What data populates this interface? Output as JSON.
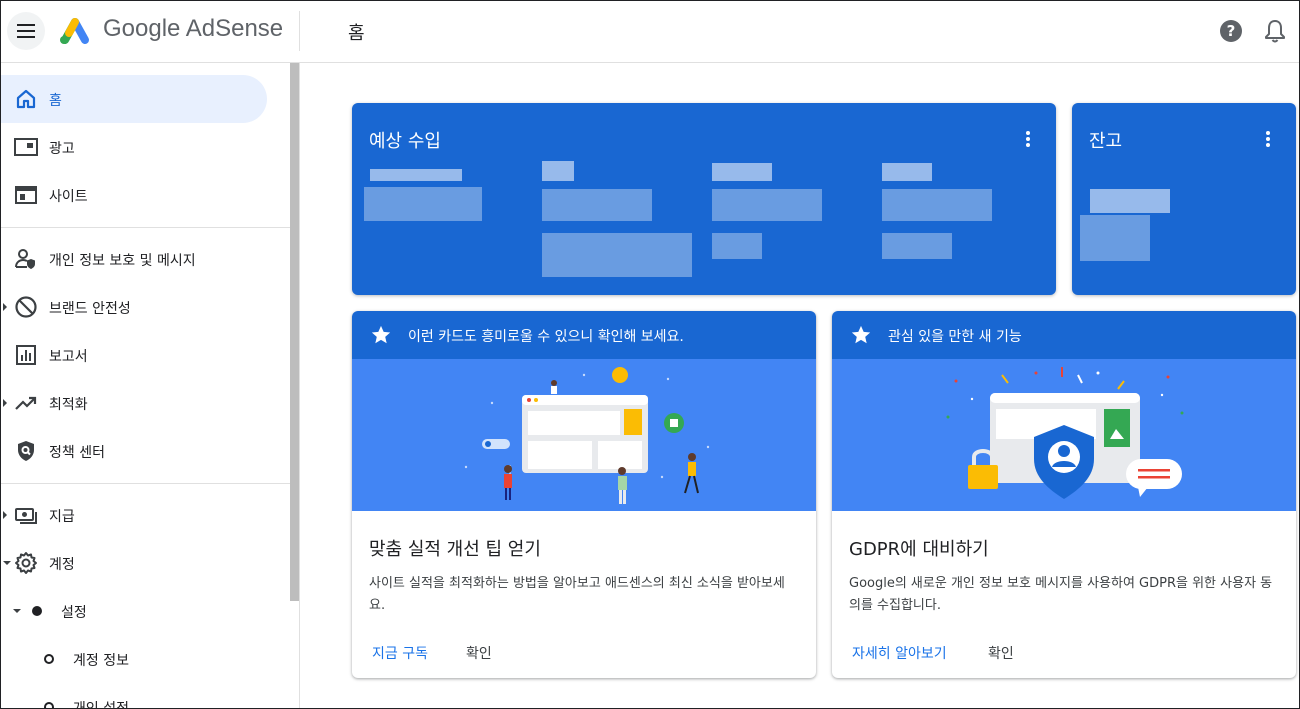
{
  "header": {
    "brand": "Google AdSense",
    "page_title": "홈"
  },
  "sidebar": {
    "items": [
      {
        "label": "홈"
      },
      {
        "label": "광고"
      },
      {
        "label": "사이트"
      },
      {
        "label": "개인 정보 보호 및 메시지"
      },
      {
        "label": "브랜드 안전성"
      },
      {
        "label": "보고서"
      },
      {
        "label": "최적화"
      },
      {
        "label": "정책 센터"
      },
      {
        "label": "지급"
      },
      {
        "label": "계정"
      }
    ],
    "sub_items": [
      {
        "label": "설정"
      },
      {
        "label": "계정 정보"
      },
      {
        "label": "개인 설정"
      }
    ]
  },
  "cards": {
    "earnings": {
      "title": "예상 수입"
    },
    "balance": {
      "title": "잔고"
    },
    "tips": {
      "header": "이런 카드도 흥미로울 수 있으니 확인해 보세요.",
      "title": "맞춤 실적 개선 팁 얻기",
      "desc": "사이트 실적을 최적화하는 방법을 알아보고 애드센스의 최신 소식을 받아보세요.",
      "action_primary": "지금 구독",
      "action_secondary": "확인"
    },
    "gdpr": {
      "header": "관심 있을 만한 새 기능",
      "title": "GDPR에 대비하기",
      "desc": "Google의 새로운 개인 정보 보호 메시지를 사용하여 GDPR을 위한 사용자 동의를 수집합니다.",
      "action_primary": "자세히 알아보기",
      "action_secondary": "확인"
    }
  },
  "colors": {
    "primary_blue": "#1967d2",
    "illustration_blue": "#4285f4",
    "link_blue": "#1a73e8",
    "active_nav_bg": "#e8f0fe"
  }
}
